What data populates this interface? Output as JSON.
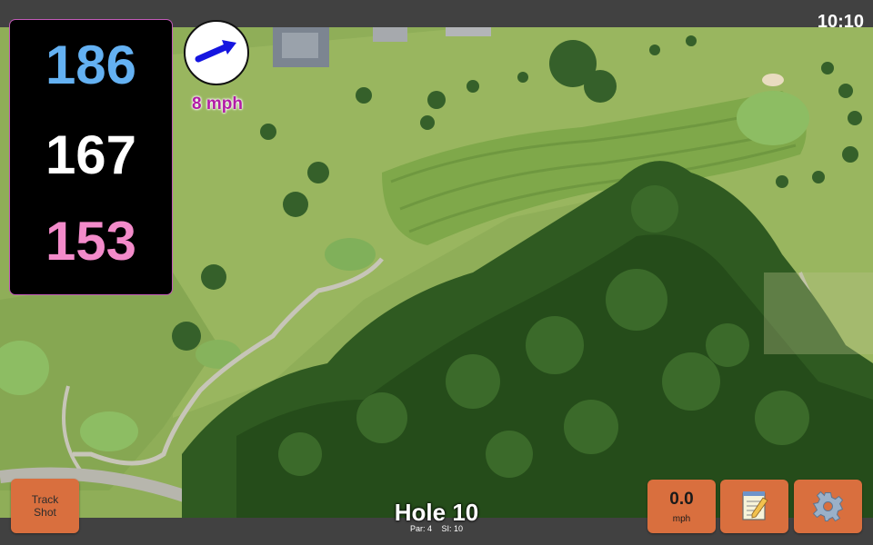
{
  "status_bar": {
    "time": "10:10"
  },
  "distances": {
    "back": "186",
    "middle": "167",
    "front": "153"
  },
  "wind": {
    "speed": "8 mph",
    "direction_icon": "arrow-icon"
  },
  "hole": {
    "title": "Hole 10",
    "par": "Par: 4",
    "stroke_index": "SI: 10"
  },
  "buttons": {
    "track_shot_line1": "Track",
    "track_shot_line2": "Shot",
    "speed_value": "0.0",
    "speed_unit": "mph",
    "notes_icon": "notepad-icon",
    "settings_icon": "gear-icon"
  },
  "colors": {
    "back": "#64b1f2",
    "middle": "#ffffff",
    "front": "#f38bca",
    "button": "#d96f3e",
    "wind_text": "#b21ca6"
  }
}
